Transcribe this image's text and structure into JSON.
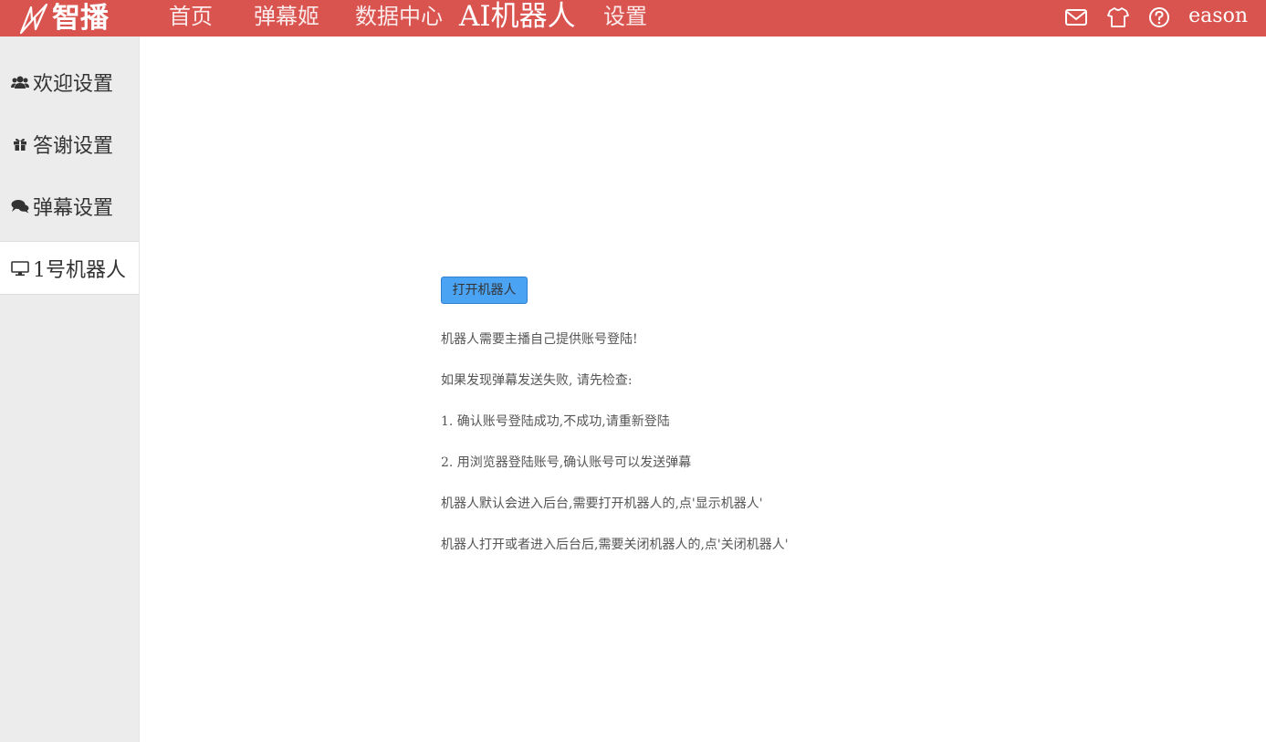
{
  "header": {
    "brand_text": "智播",
    "nav": [
      "首页",
      "弹幕姬",
      "数据中心",
      "AI机器人",
      "设置"
    ],
    "active_nav": "AI机器人",
    "icons": [
      "mail-icon",
      "shirt-icon",
      "help-icon"
    ],
    "username": "eason",
    "bg_color": "#d9534f"
  },
  "sidebar": {
    "items": [
      {
        "label": "欢迎设置",
        "icon": "users-icon"
      },
      {
        "label": "答谢设置",
        "icon": "gift-icon"
      },
      {
        "label": "弹幕设置",
        "icon": "comments-icon"
      },
      {
        "label": "1号机器人",
        "icon": "desktop-icon"
      }
    ],
    "active_item": "1号机器人"
  },
  "main": {
    "open_button_label": "打开机器人",
    "open_button_color": "#4ba3f4",
    "lines": [
      "机器人需要主播自己提供账号登陆!",
      "如果发现弹幕发送失败, 请先检查:",
      "1.  确认账号登陆成功,不成功,请重新登陆",
      "2.  用浏览器登陆账号,确认账号可以发送弹幕",
      "机器人默认会进入后台,需要打开机器人的,点'显示机器人'",
      "机器人打开或者进入后台后,需要关闭机器人的,点'关闭机器人'"
    ]
  }
}
